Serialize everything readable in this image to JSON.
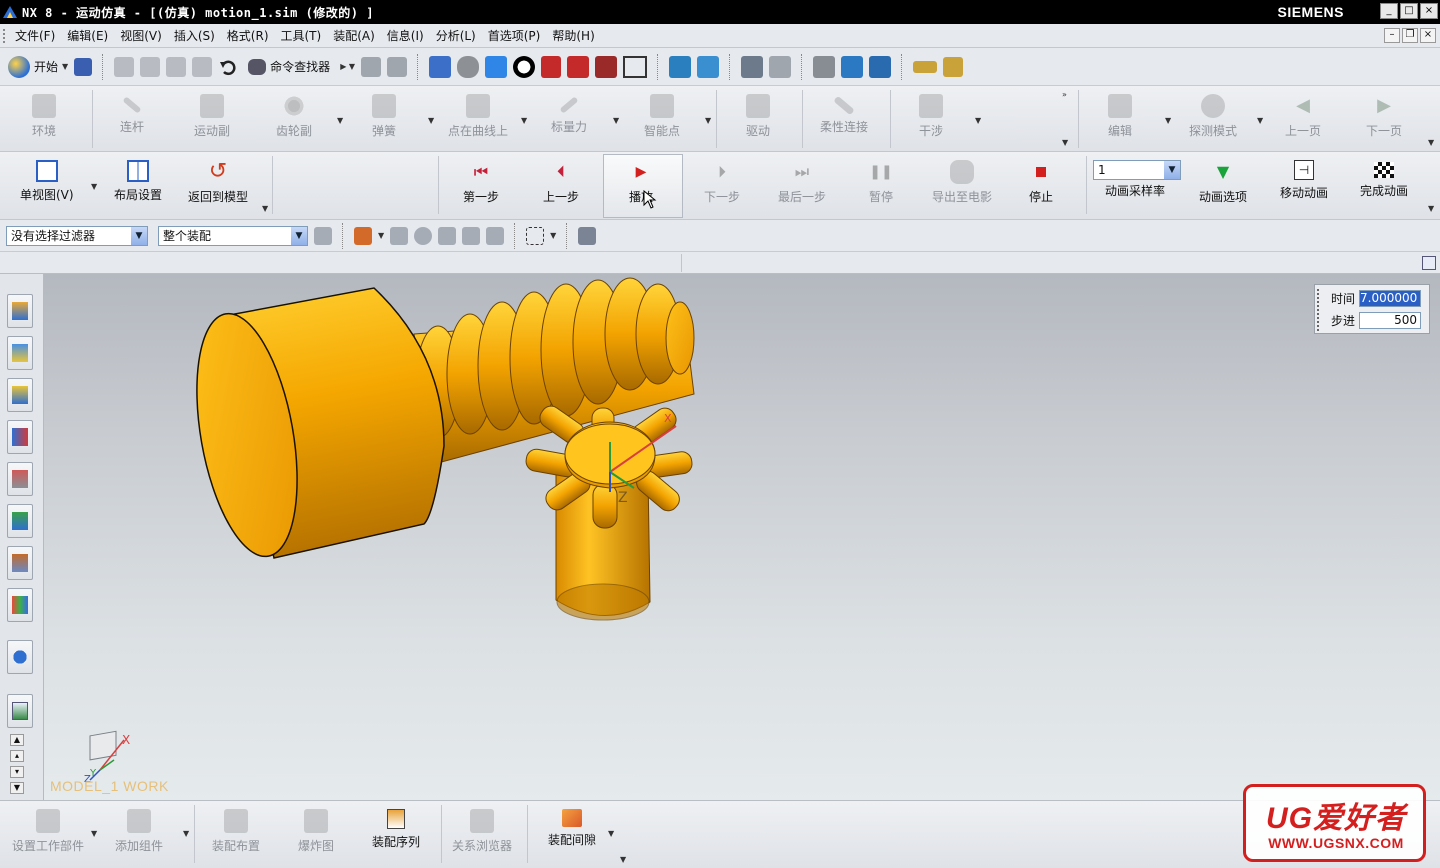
{
  "titlebar": {
    "title": "NX 8 - 运动仿真 - [(仿真) motion_1.sim  (修改的) ]",
    "brand": "SIEMENS",
    "minimize": "_",
    "maximize": "□",
    "close": "×"
  },
  "menubar": {
    "items": [
      "文件(F)",
      "编辑(E)",
      "视图(V)",
      "插入(S)",
      "格式(R)",
      "工具(T)",
      "装配(A)",
      "信息(I)",
      "分析(L)",
      "首选项(P)",
      "帮助(H)"
    ]
  },
  "stdbar": {
    "start_label": "开始",
    "command_finder_label": "命令查找器"
  },
  "ribbon1": {
    "items": [
      "环境",
      "连杆",
      "运动副",
      "齿轮副",
      "弹簧",
      "点在曲线上",
      "标量力",
      "智能点",
      "驱动",
      "柔性连接",
      "干涉",
      "编辑",
      "探测模式",
      "上一页",
      "下一页"
    ]
  },
  "ribbon2": {
    "left": [
      "单视图(V)",
      "布局设置",
      "返回到模型"
    ],
    "playback": [
      "第一步",
      "上一步",
      "播放",
      "下一步",
      "最后一步",
      "暂停",
      "导出至电影",
      "停止"
    ],
    "sample_rate_value": "1",
    "right": [
      "动画采样率",
      "动画选项",
      "移动动画",
      "完成动画"
    ]
  },
  "filterbar": {
    "selection_filter": "没有选择过滤器",
    "scope": "整个装配"
  },
  "timepanel": {
    "time_label": "时间",
    "time_value": "7.000000",
    "step_label": "步进",
    "step_value": "500"
  },
  "viewport": {
    "wcs_label": "MODEL_1 WORK",
    "axis_x": "X",
    "axis_y": "Y",
    "axis_z": "Z",
    "csys_mark": "Z"
  },
  "bottombar": {
    "items": [
      "设置工作部件",
      "添加组件",
      "装配布置",
      "爆炸图",
      "装配序列",
      "关系浏览器",
      "装配间隙"
    ]
  },
  "watermark": {
    "title": "UG爱好者",
    "url": "WWW.UGSNX.COM"
  },
  "colors": {
    "model_gold": "#f2a800",
    "model_dark": "#8a5a00",
    "play_red": "#d41f1f",
    "watermark_red": "#d41f1f"
  }
}
